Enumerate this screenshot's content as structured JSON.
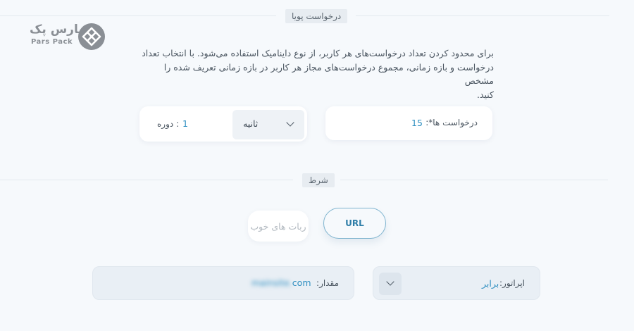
{
  "header": {
    "section_title": "درخواست پویا"
  },
  "logo": {
    "text_fa": "پارس پک",
    "text_en": "Pars Pack",
    "icon": "parspack-diamond-icon"
  },
  "description": {
    "line1": "برای محدود کردن تعداد درخواست‌های هر کاربر، از نوع داینامیک استفاده می‌شود. با انتخاب تعداد",
    "line2": "درخواست و بازه زمانی، مجموع درخواست‌های مجاز هر کاربر در بازه زمانی تعریف شده را مشخص",
    "line3": "کنید."
  },
  "requests": {
    "label": "درخواست ها",
    "required_mark": "*:",
    "value": "15"
  },
  "period": {
    "label": ": دوره",
    "value": "1",
    "unit_selected": "ثانیه",
    "unit_icon": "chevron-down-icon"
  },
  "condition": {
    "section_title": "شرط"
  },
  "tabs": [
    {
      "label": "URL",
      "active": true
    },
    {
      "label": "ربات های خوب",
      "active": false
    }
  ],
  "operator": {
    "label": "اپراتور:",
    "value": "برابر",
    "icon": "chevron-down-icon"
  },
  "amount": {
    "label": "مقدار:",
    "value_suffix": "com",
    "value_blurred": "mainsite."
  },
  "colors": {
    "accent": "#2f8fc1",
    "background": "#f6f9fc",
    "border_active": "#7fb4cf"
  }
}
